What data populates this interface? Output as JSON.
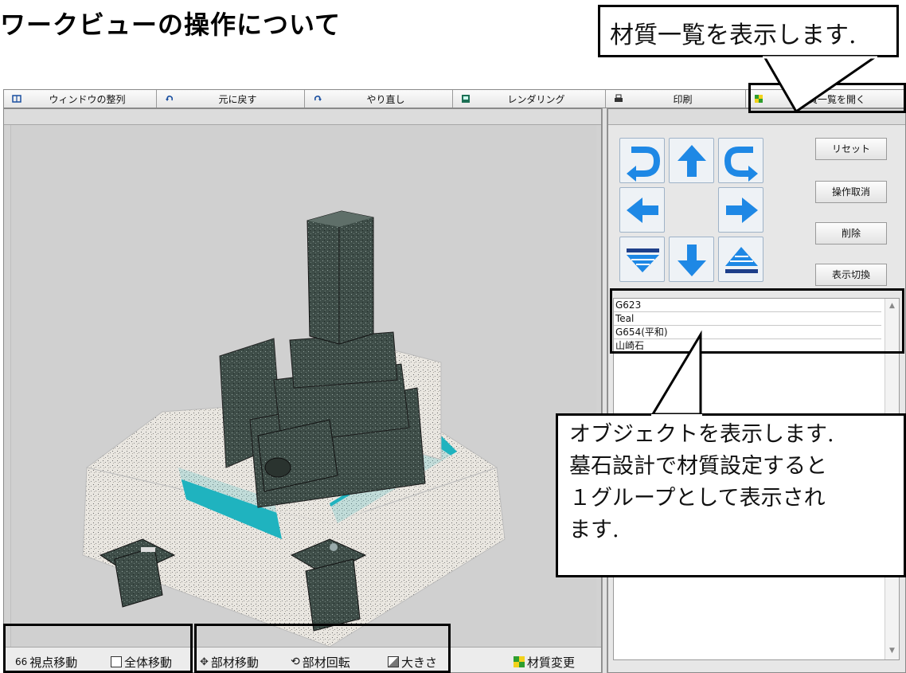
{
  "page": {
    "title": "ワークビューの操作について"
  },
  "callouts": {
    "materials": "材質一覧を表示します.",
    "objects": [
      "オブジェクトを表示します.",
      "墓石設計で材質設定すると",
      "１グループとして表示され",
      "ます."
    ]
  },
  "toolbar": {
    "items": [
      {
        "label": "ウィンドウの整列",
        "icon": "window-arrange-icon"
      },
      {
        "label": "元に戻す",
        "icon": "undo-icon"
      },
      {
        "label": "やり直し",
        "icon": "redo-icon"
      },
      {
        "label": "レンダリング",
        "icon": "render-icon"
      },
      {
        "label": "印刷",
        "icon": "print-icon"
      },
      {
        "label": "材質一覧を開く",
        "icon": "material-grid-icon"
      }
    ]
  },
  "view_bottom": {
    "viewpoint_move": "視点移動",
    "whole_move": "全体移動",
    "part_move": "部材移動",
    "part_rotate": "部材回転",
    "size": "大きさ",
    "material_change": "材質変更"
  },
  "control": {
    "buttons": {
      "reset": "リセット",
      "undo_op": "操作取消",
      "delete": "削除",
      "toggle_view": "表示切換"
    },
    "arrows": [
      "rotate-left-icon",
      "arrow-up-icon",
      "rotate-right-icon",
      "arrow-left-icon",
      "arrow-right-icon",
      "arrow-down-double-icon",
      "arrow-down-icon",
      "arrow-up-double-icon"
    ],
    "objects": [
      "G623",
      "Teal",
      "G654(平和)",
      "山崎石"
    ]
  },
  "colors": {
    "arrow_blue": "#1e88e5",
    "teal_base": "#1fb3bf",
    "material_green": "#2e9e2e",
    "material_yellow": "#f2d21b"
  }
}
